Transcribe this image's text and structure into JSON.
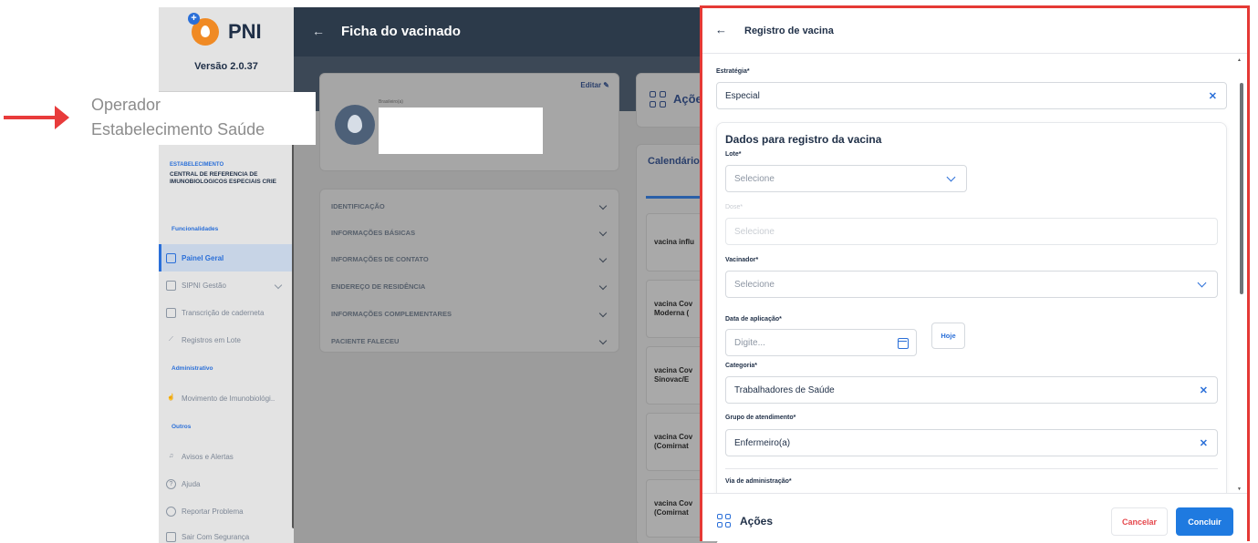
{
  "sidebar": {
    "logo_text": "PNI",
    "version": "Versão 2.0.37",
    "estab_label": "ESTABELECIMENTO",
    "estab_name": "CENTRAL DE REFERENCIA DE IMUNOBIOLOGICOS ESPECIAIS CRIE",
    "section_funcionalidades": "Funcionalidades",
    "section_administrativo": "Administrativo",
    "section_outros": "Outros",
    "items": [
      {
        "label": "Painel Geral"
      },
      {
        "label": "SIPNI Gestão"
      },
      {
        "label": "Transcrição de caderneta"
      },
      {
        "label": "Registros em Lote"
      },
      {
        "label": "Movimento de Imunobiológi.."
      },
      {
        "label": "Avisos e Alertas"
      },
      {
        "label": "Ajuda"
      },
      {
        "label": "Reportar Problema"
      },
      {
        "label": "Sair Com Segurança"
      }
    ]
  },
  "callout": {
    "line1": "Operador",
    "line2": "Estabelecimento Saúde"
  },
  "background": {
    "title": "Ficha do vacinado",
    "edit": "Editar",
    "nationality": "Brasileiro(a)",
    "info_rows": [
      "IDENTIFICAÇÃO",
      "INFORMAÇÕES BÁSICAS",
      "INFORMAÇÕES DE CONTATO",
      "ENDEREÇO DE RESIDÊNCIA",
      "INFORMAÇÕES COMPLEMENTARES",
      "PACIENTE FALECEU"
    ],
    "acoes": "Açõe",
    "calendar": "Calendário",
    "vaccines": [
      {
        "line1": "vacina influ",
        "line2": ""
      },
      {
        "line1": "vacina Cov",
        "line2": "Moderna ("
      },
      {
        "line1": "vacina Cov",
        "line2": "Sinovac/E"
      },
      {
        "line1": "vacina Cov",
        "line2": "(Comirnat"
      },
      {
        "line1": "vacina Cov",
        "line2": "(Comirnat"
      }
    ]
  },
  "modal": {
    "title": "Registro de vacina",
    "estrategia_label": "Estratégia*",
    "estrategia_value": "Especial",
    "section_title": "Dados para registro da vacina",
    "lote_label": "Lote*",
    "lote_placeholder": "Selecione",
    "dose_label": "Dose*",
    "dose_placeholder": "Selecione",
    "vacinador_label": "Vacinador*",
    "vacinador_placeholder": "Selecione",
    "data_label": "Data de aplicação*",
    "data_placeholder": "Digite...",
    "hoje": "Hoje",
    "categoria_label": "Categoria*",
    "categoria_value": "Trabalhadores de Saúde",
    "grupo_label": "Grupo de atendimento*",
    "grupo_value": "Enfermeiro(a)",
    "via_label": "Via de administração*",
    "footer_acoes": "Ações",
    "cancel": "Cancelar",
    "ok": "Concluir"
  }
}
